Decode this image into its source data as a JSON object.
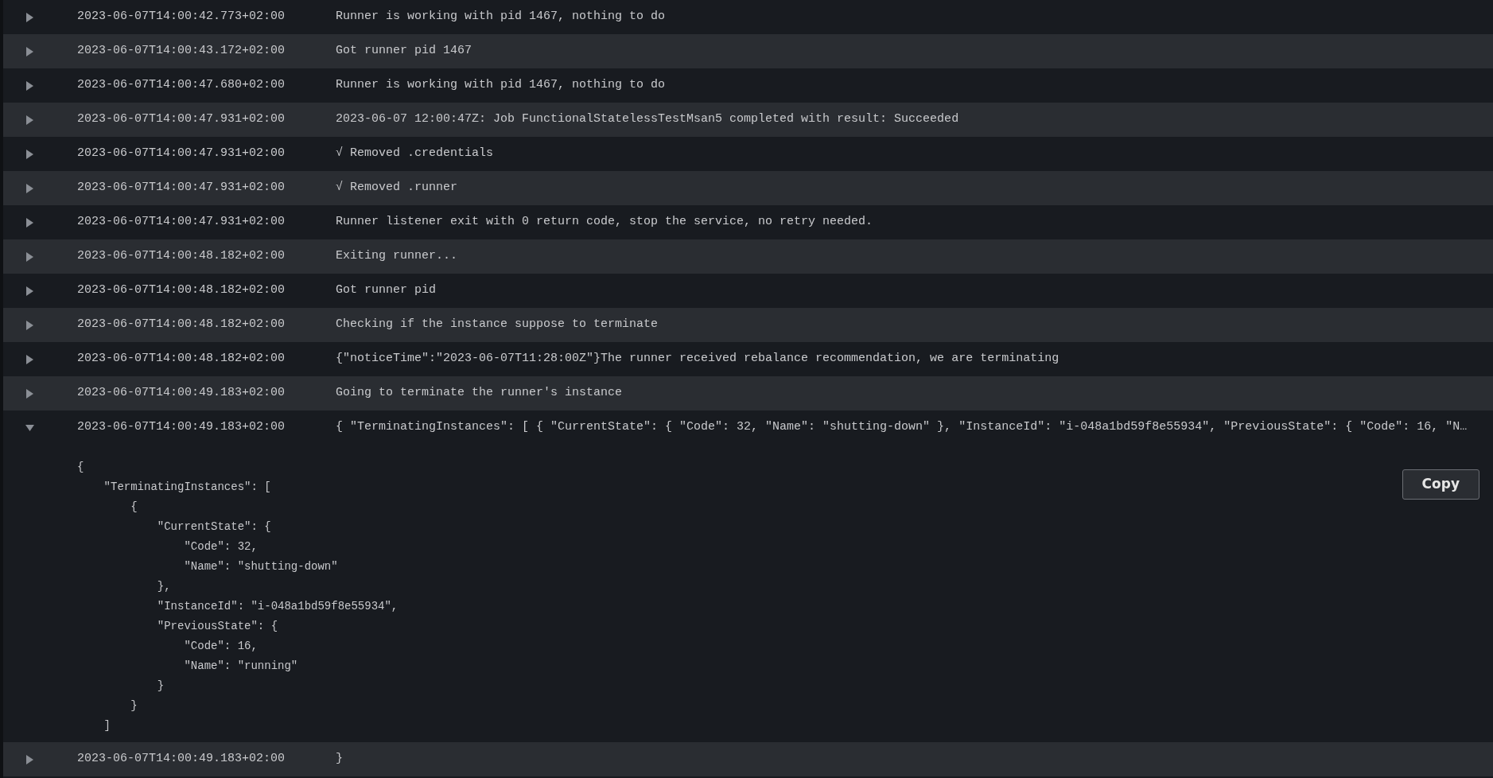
{
  "log_rows": [
    {
      "timestamp": "2023-06-07T14:00:42.773+02:00",
      "message": "Runner is working with pid 1467, nothing to do",
      "expanded": false
    },
    {
      "timestamp": "2023-06-07T14:00:43.172+02:00",
      "message": "Got runner pid 1467",
      "expanded": false
    },
    {
      "timestamp": "2023-06-07T14:00:47.680+02:00",
      "message": "Runner is working with pid 1467, nothing to do",
      "expanded": false
    },
    {
      "timestamp": "2023-06-07T14:00:47.931+02:00",
      "message": "2023-06-07 12:00:47Z: Job FunctionalStatelessTestMsan5 completed with result: Succeeded",
      "expanded": false
    },
    {
      "timestamp": "2023-06-07T14:00:47.931+02:00",
      "message": "√ Removed .credentials",
      "expanded": false
    },
    {
      "timestamp": "2023-06-07T14:00:47.931+02:00",
      "message": "√ Removed .runner",
      "expanded": false
    },
    {
      "timestamp": "2023-06-07T14:00:47.931+02:00",
      "message": "Runner listener exit with 0 return code, stop the service, no retry needed.",
      "expanded": false
    },
    {
      "timestamp": "2023-06-07T14:00:48.182+02:00",
      "message": "Exiting runner...",
      "expanded": false
    },
    {
      "timestamp": "2023-06-07T14:00:48.182+02:00",
      "message": "Got runner pid",
      "expanded": false
    },
    {
      "timestamp": "2023-06-07T14:00:48.182+02:00",
      "message": "Checking if the instance suppose to terminate",
      "expanded": false
    },
    {
      "timestamp": "2023-06-07T14:00:48.182+02:00",
      "message": "{\"noticeTime\":\"2023-06-07T11:28:00Z\"}The runner received rebalance recommendation, we are terminating",
      "expanded": false
    },
    {
      "timestamp": "2023-06-07T14:00:49.183+02:00",
      "message": "Going to terminate the runner's instance",
      "expanded": false
    },
    {
      "timestamp": "2023-06-07T14:00:49.183+02:00",
      "message": "{ \"TerminatingInstances\": [ { \"CurrentState\": { \"Code\": 32, \"Name\": \"shutting-down\" }, \"InstanceId\": \"i-048a1bd59f8e55934\", \"PreviousState\": { \"Code\": 16, \"N…",
      "expanded": true,
      "details": {
        "copy_button": "Copy",
        "lines": [
          "{",
          "    \"TerminatingInstances\": [",
          "        {",
          "            \"CurrentState\": {",
          "                \"Code\": 32,",
          "                \"Name\": \"shutting-down\"",
          "            },",
          "            \"InstanceId\": \"i-048a1bd59f8e55934\",",
          "            \"PreviousState\": {",
          "                \"Code\": 16,",
          "                \"Name\": \"running\"",
          "            }",
          "        }",
          "    ]"
        ]
      }
    },
    {
      "timestamp": "2023-06-07T14:00:49.183+02:00",
      "message": "}",
      "expanded": false
    }
  ]
}
